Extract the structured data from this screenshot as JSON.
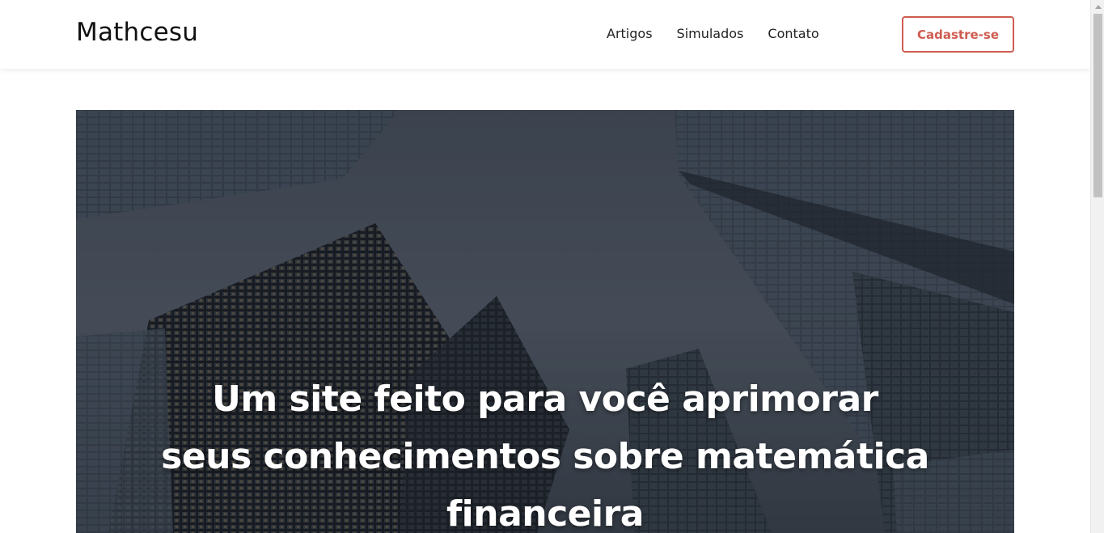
{
  "header": {
    "brand": "Mathcesu",
    "nav": [
      "Artigos",
      "Simulados",
      "Contato"
    ],
    "cta_label": "Cadastre-se"
  },
  "hero": {
    "title_line1": "Um site feito para você aprimorar",
    "title_line2": "seus conhecimentos sobre matemática",
    "title_line3": "financeira"
  },
  "colors": {
    "accent": "#cf5c50",
    "text": "#111111",
    "hero_overlay": "#2c333d"
  }
}
